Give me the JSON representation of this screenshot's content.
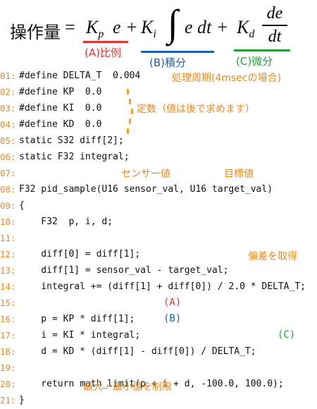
{
  "formula": {
    "lhs": "操作量",
    "eq": "=",
    "kp": "K",
    "kp_sub": "p",
    "term1": "e +",
    "ki": "K",
    "ki_sub": "i",
    "integral": "∫",
    "term2": "e dt +",
    "kd": "K",
    "kd_sub": "d",
    "frac_num": "de",
    "frac_den": "dt",
    "label_a": "(A)比例",
    "label_b": "(B)積分",
    "label_c": "(C)微分",
    "colors": {
      "a": "#e8332f",
      "b": "#1f5fa8",
      "c": "#22a33a",
      "note": "#e58a1f"
    }
  },
  "code": {
    "lines": [
      {
        "no": "01:",
        "text": "#define DELTA_T  0.004"
      },
      {
        "no": "02:",
        "text": "#define KP  0.0"
      },
      {
        "no": "03:",
        "text": "#define KI  0.0"
      },
      {
        "no": "04:",
        "text": "#define KD  0.0"
      },
      {
        "no": "05:",
        "text": "static S32 diff[2];"
      },
      {
        "no": "06:",
        "text": "static F32 integral;"
      },
      {
        "no": "07:",
        "text": ""
      },
      {
        "no": "08:",
        "text": "F32 pid_sample(U16 sensor_val, U16 target_val)"
      },
      {
        "no": "09:",
        "text": "{"
      },
      {
        "no": "10:",
        "text": "    F32  p, i, d;"
      },
      {
        "no": "11:",
        "text": ""
      },
      {
        "no": "12:",
        "text": "    diff[0] = diff[1];"
      },
      {
        "no": "13:",
        "text": "    diff[1] = sensor_val - target_val;"
      },
      {
        "no": "14:",
        "text": "    integral += (diff[1] + diff[0]) / 2.0 * DELTA_T;"
      },
      {
        "no": "15:",
        "text": ""
      },
      {
        "no": "16:",
        "text": "    p = KP * diff[1];"
      },
      {
        "no": "17:",
        "text": "    i = KI * integral;"
      },
      {
        "no": "18:",
        "text": "    d = KD * (diff[1] - diff[0]) / DELTA_T;"
      },
      {
        "no": "19:",
        "text": ""
      },
      {
        "no": "20:",
        "text": "    return math_limit(p + i + d, -100.0, 100.0);"
      },
      {
        "no": "21:",
        "text": "}"
      }
    ]
  },
  "notes": {
    "period": "処理周期(4msecの場合)",
    "constants": "定数（値は後で求めます）",
    "sensor": "センサー値",
    "target": "目標値",
    "deviation": "偏差を取得",
    "limit": "最大・最小値を制限",
    "mark_a": "(A)",
    "mark_b": "(B)",
    "mark_c": "(C)"
  }
}
